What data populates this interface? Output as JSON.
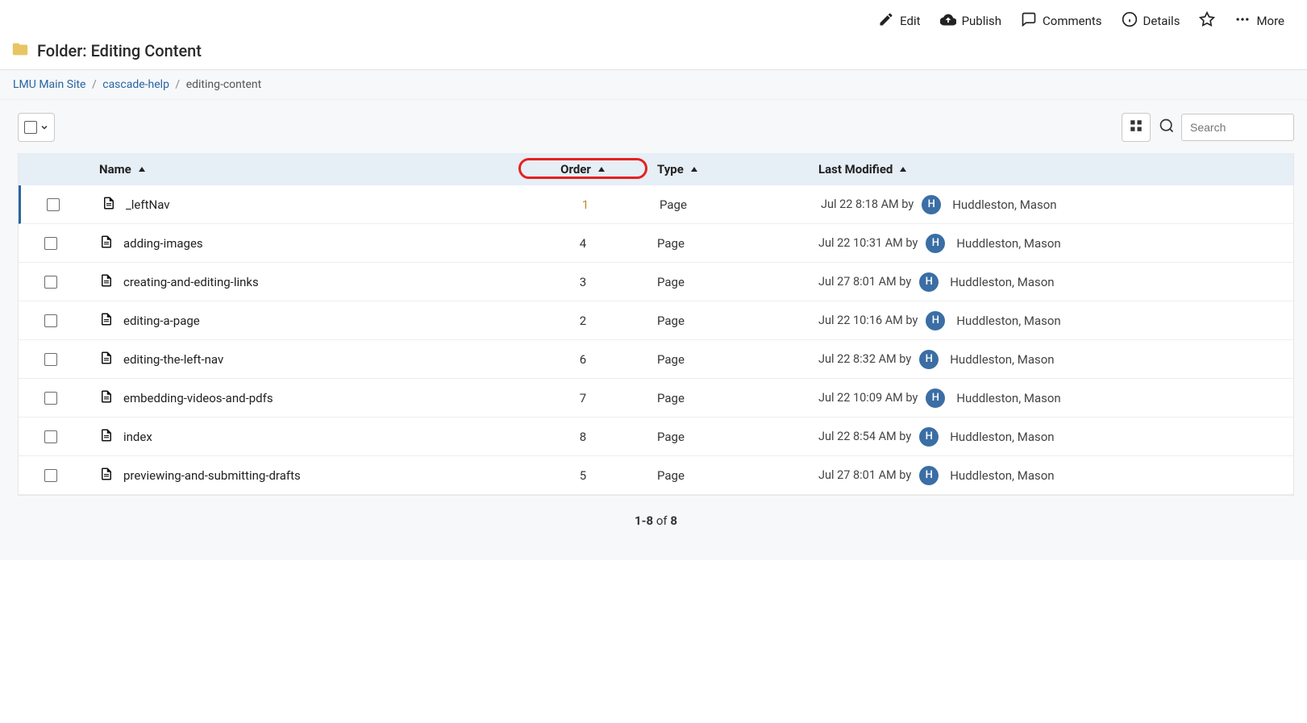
{
  "toolbar": {
    "edit": "Edit",
    "publish": "Publish",
    "comments": "Comments",
    "details": "Details",
    "more": "More"
  },
  "header": {
    "folder_prefix": "Folder: ",
    "folder_name": "Editing Content"
  },
  "breadcrumb": {
    "site": "LMU Main Site",
    "level1": "cascade-help",
    "current": "editing-content",
    "sep": "/"
  },
  "search": {
    "placeholder": "Search"
  },
  "columns": {
    "name": "Name",
    "order": "Order",
    "type": "Type",
    "modified": "Last Modified"
  },
  "rows": [
    {
      "name": "_leftNav",
      "order": "1",
      "type": "Page",
      "modified": "Jul 22 8:18 AM by",
      "avatar": "H",
      "author": "Huddleston, Mason"
    },
    {
      "name": "adding-images",
      "order": "4",
      "type": "Page",
      "modified": "Jul 22 10:31 AM by",
      "avatar": "H",
      "author": "Huddleston, Mason"
    },
    {
      "name": "creating-and-editing-links",
      "order": "3",
      "type": "Page",
      "modified": "Jul 27 8:01 AM by",
      "avatar": "H",
      "author": "Huddleston, Mason"
    },
    {
      "name": "editing-a-page",
      "order": "2",
      "type": "Page",
      "modified": "Jul 22 10:16 AM by",
      "avatar": "H",
      "author": "Huddleston, Mason"
    },
    {
      "name": "editing-the-left-nav",
      "order": "6",
      "type": "Page",
      "modified": "Jul 22 8:32 AM by",
      "avatar": "H",
      "author": "Huddleston, Mason"
    },
    {
      "name": "embedding-videos-and-pdfs",
      "order": "7",
      "type": "Page",
      "modified": "Jul 22 10:09 AM by",
      "avatar": "H",
      "author": "Huddleston, Mason"
    },
    {
      "name": "index",
      "order": "8",
      "type": "Page",
      "modified": "Jul 22 8:54 AM by",
      "avatar": "H",
      "author": "Huddleston, Mason"
    },
    {
      "name": "previewing-and-submitting-drafts",
      "order": "5",
      "type": "Page",
      "modified": "Jul 27 8:01 AM by",
      "avatar": "H",
      "author": "Huddleston, Mason"
    }
  ],
  "pagination": {
    "range": "1-8",
    "of": " of ",
    "total": "8"
  }
}
